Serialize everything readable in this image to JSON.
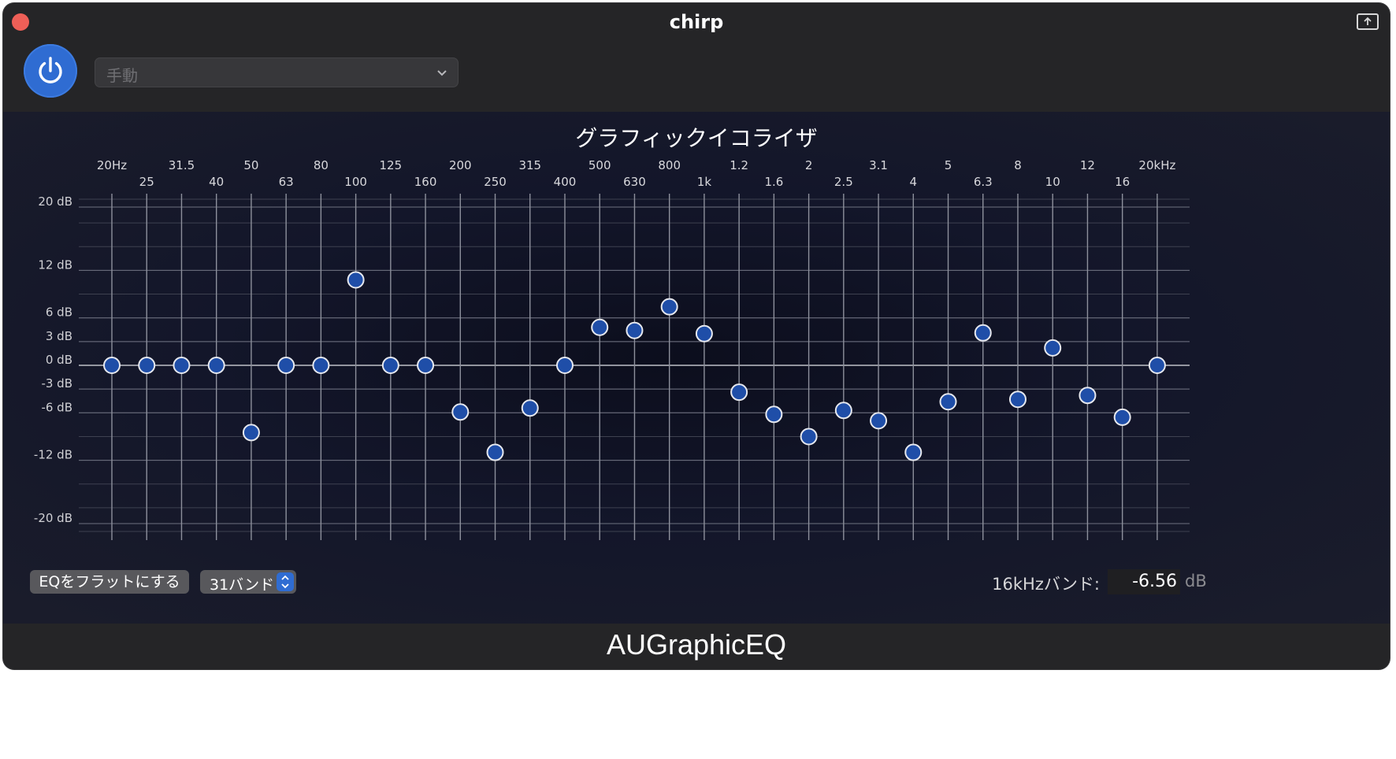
{
  "window": {
    "title": "chirp"
  },
  "toolbar": {
    "preset_value": "手動"
  },
  "eq": {
    "title": "グラフィックイコライザ",
    "db_ticks": [
      {
        "value": 20,
        "label": "20 dB"
      },
      {
        "value": 12,
        "label": "12 dB"
      },
      {
        "value": 6,
        "label": "6 dB"
      },
      {
        "value": 3,
        "label": "3 dB"
      },
      {
        "value": 0,
        "label": "0 dB"
      },
      {
        "value": -3,
        "label": "-3 dB"
      },
      {
        "value": -6,
        "label": "-6 dB"
      },
      {
        "value": -12,
        "label": "-12 dB"
      },
      {
        "value": -20,
        "label": "-20 dB"
      }
    ],
    "freq_labels": [
      "20Hz",
      "25",
      "31.5",
      "40",
      "50",
      "63",
      "80",
      "100",
      "125",
      "160",
      "200",
      "250",
      "315",
      "400",
      "500",
      "630",
      "800",
      "1k",
      "1.2",
      "1.6",
      "2",
      "2.5",
      "3.1",
      "4",
      "5",
      "6.3",
      "8",
      "10",
      "12",
      "16",
      "20kHz"
    ],
    "gains": [
      0,
      0,
      0,
      0,
      -8.5,
      0,
      0,
      10.8,
      0,
      0,
      -5.9,
      -11,
      -5.4,
      0,
      4.8,
      4.4,
      7.4,
      4,
      -3.4,
      -6.2,
      -9,
      -5.7,
      -7,
      -11,
      -4.6,
      4.1,
      -4.3,
      2.2,
      -3.8,
      -6.56,
      0
    ],
    "flat_button_label": "EQをフラットにする",
    "band_count_value": "31バンド",
    "selected_band_label": "16kHzバンド:",
    "selected_band_value": "-6.56",
    "selected_band_unit": "dB"
  },
  "footer": {
    "plugin_name": "AUGraphicEQ"
  },
  "colors": {
    "accent": "#2f6cd2",
    "slider_handle": "#1f4ea8",
    "close_button": "#ee5f57"
  }
}
